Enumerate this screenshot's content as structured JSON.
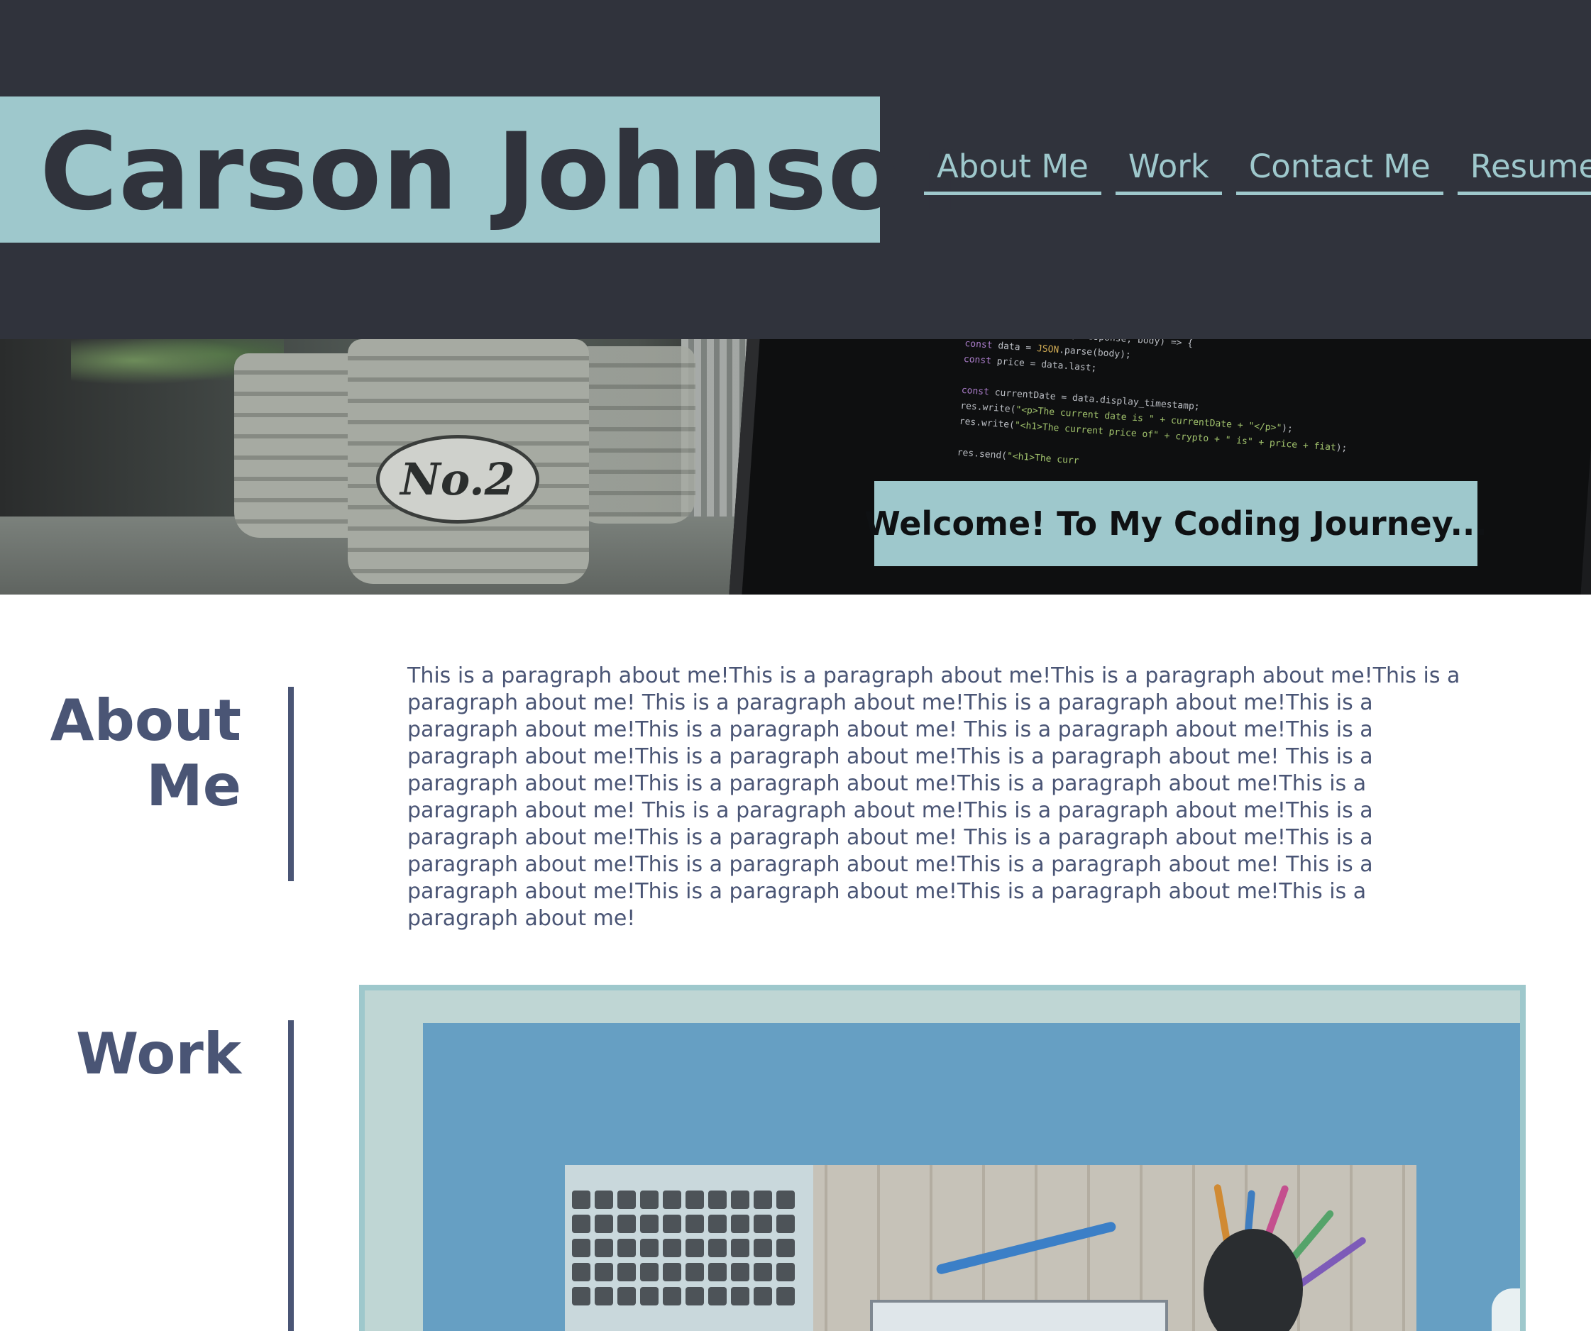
{
  "header": {
    "name": "Carson Johnson",
    "nav": [
      {
        "label": "About Me"
      },
      {
        "label": "Work"
      },
      {
        "label": "Contact Me"
      },
      {
        "label": "Resume"
      }
    ]
  },
  "hero": {
    "welcome": "Welcome! To My Coding Journey...",
    "pot_label": "No.2"
  },
  "about": {
    "title_line1": "About",
    "title_line2": "Me",
    "paragraph": "This is a paragraph about me!This is a paragraph about me!This is a paragraph about me!This is a paragraph about me! This is a paragraph about me!This is a paragraph about me!This is a paragraph about me!This is a paragraph about me! This is a paragraph about me!This is a paragraph about me!This is a paragraph about me!This is a paragraph about me! This is a paragraph about me!This is a paragraph about me!This is a paragraph about me!This is a paragraph about me! This is a paragraph about me!This is a paragraph about me!This is a paragraph about me!This is a paragraph about me! This is a paragraph about me!This is a paragraph about me!This is a paragraph about me!This is a paragraph about me! This is a paragraph about me!This is a paragraph about me!This is a paragraph about me!This is a paragraph about me!"
  },
  "work": {
    "title": "Work"
  },
  "colors": {
    "header_bg": "#30333c",
    "accent": "#9ec8cc",
    "section_text": "#4a5575",
    "work_card_bg": "#669fc3"
  }
}
